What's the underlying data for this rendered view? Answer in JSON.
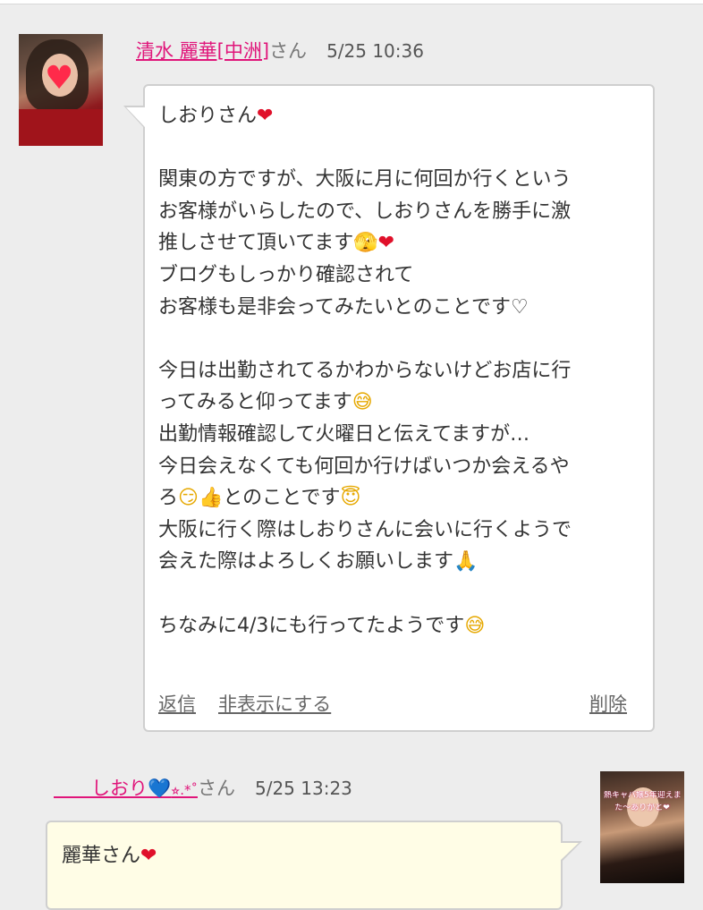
{
  "message1": {
    "sender_name": "清水 麗華[中洲]",
    "sender_suffix": "さん",
    "timestamp": "5/25 10:36",
    "lines": [
      [
        "しおりさん",
        "❤"
      ],
      [
        "",
        ""
      ],
      [
        "関東の方ですが、大阪に月に何回か行くという",
        ""
      ],
      [
        "お客様がいらしたので、しおりさんを勝手に激",
        ""
      ],
      [
        "推しさせて頂いてます",
        "🫣❤"
      ],
      [
        "ブログもしっかり確認されて",
        ""
      ],
      [
        "お客様も是非会ってみたいとのことです♡",
        ""
      ],
      [
        "",
        ""
      ],
      [
        "今日は出勤されてるかわからないけどお店に行",
        ""
      ],
      [
        "ってみると仰ってます",
        "😅"
      ],
      [
        "出勤情報確認して火曜日と伝えてますが…",
        ""
      ],
      [
        "今日会えなくても何回か行けばいつか会えるや",
        ""
      ],
      [
        "ろ",
        "😏👍"
      ],
      [
        "大阪に行く際はしおりさんに会いに行くようで",
        ""
      ],
      [
        "会えた際はよろしくお願いします",
        "🙏"
      ],
      [
        "",
        ""
      ],
      [
        "ちなみに4/3にも行ってたようです",
        "😅"
      ]
    ],
    "line13_tail_text": "とのことです",
    "line13_tail_emoji": "😇",
    "actions": {
      "reply": "返信",
      "hide": "非表示にする",
      "delete": "削除"
    }
  },
  "message2": {
    "sender_name": "　　しおり",
    "sender_heart": "💙",
    "sender_deco": "⭐︎.*˚",
    "sender_suffix": "さん",
    "timestamp": "5/25 13:23",
    "text": "麗華さん",
    "emoji": "❤",
    "avatar_banner_line1": "熱キャバ嬢5年迎えまし",
    "avatar_banner_line2": "た〜ありがと❤"
  },
  "colors": {
    "username": "#e0157a",
    "background": "#ededed",
    "received_bubble": "#ffffff",
    "sent_bubble": "#fffde6"
  }
}
